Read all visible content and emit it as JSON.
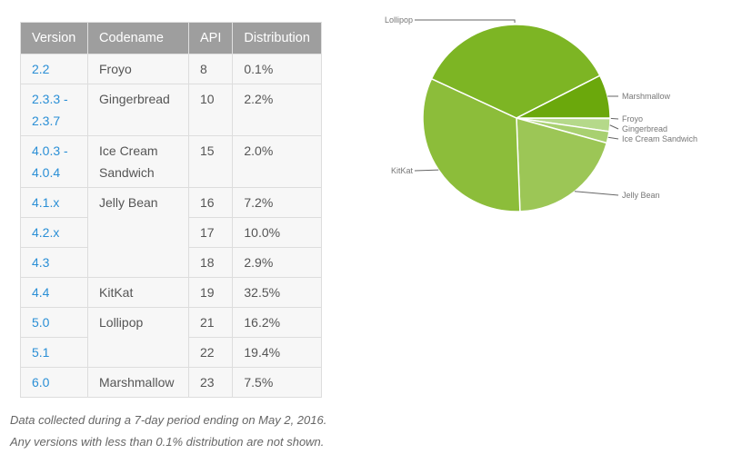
{
  "table": {
    "headers": [
      "Version",
      "Codename",
      "API",
      "Distribution"
    ],
    "rows": [
      {
        "version": [
          "2.2"
        ],
        "codename": [
          "Froyo"
        ],
        "codename_rowspan": 1,
        "api": "8",
        "distribution": "0.1%"
      },
      {
        "version": [
          "2.3.3 -",
          "2.3.7"
        ],
        "codename": [
          "Gingerbread"
        ],
        "codename_rowspan": 1,
        "api": "10",
        "distribution": "2.2%"
      },
      {
        "version": [
          "4.0.3 -",
          "4.0.4"
        ],
        "codename": [
          "Ice Cream",
          "Sandwich"
        ],
        "codename_rowspan": 1,
        "api": "15",
        "distribution": "2.0%"
      },
      {
        "version": [
          "4.1.x"
        ],
        "codename": [
          "Jelly Bean"
        ],
        "codename_rowspan": 3,
        "api": "16",
        "distribution": "7.2%"
      },
      {
        "version": [
          "4.2.x"
        ],
        "codename": null,
        "api": "17",
        "distribution": "10.0%"
      },
      {
        "version": [
          "4.3"
        ],
        "codename": null,
        "api": "18",
        "distribution": "2.9%"
      },
      {
        "version": [
          "4.4"
        ],
        "codename": [
          "KitKat"
        ],
        "codename_rowspan": 1,
        "api": "19",
        "distribution": "32.5%"
      },
      {
        "version": [
          "5.0"
        ],
        "codename": [
          "Lollipop"
        ],
        "codename_rowspan": 2,
        "api": "21",
        "distribution": "16.2%"
      },
      {
        "version": [
          "5.1"
        ],
        "codename": null,
        "api": "22",
        "distribution": "19.4%"
      },
      {
        "version": [
          "6.0"
        ],
        "codename": [
          "Marshmallow"
        ],
        "codename_rowspan": 1,
        "api": "23",
        "distribution": "7.5%"
      }
    ]
  },
  "notes": [
    "Data collected during a 7-day period ending on May 2, 2016.",
    "Any versions with less than 0.1% distribution are not shown."
  ],
  "colors": {
    "header_bg": "#9e9e9e",
    "link": "#2a8fd6"
  },
  "chart_data": {
    "type": "pie",
    "title": "",
    "start": "3 o'clock, clockwise",
    "slices": [
      {
        "label": "Froyo",
        "value": 0.1,
        "color": "#c5e1a5"
      },
      {
        "label": "Gingerbread",
        "value": 2.2,
        "color": "#b5d98a"
      },
      {
        "label": "Ice Cream Sandwich",
        "value": 2.0,
        "color": "#a8d070"
      },
      {
        "label": "Jelly Bean",
        "value": 20.1,
        "color": "#9cc656"
      },
      {
        "label": "KitKat",
        "value": 32.5,
        "color": "#8cbd3a"
      },
      {
        "label": "Lollipop",
        "value": 35.6,
        "color": "#7db524"
      },
      {
        "label": "Marshmallow",
        "value": 7.5,
        "color": "#6ba80c"
      }
    ]
  }
}
